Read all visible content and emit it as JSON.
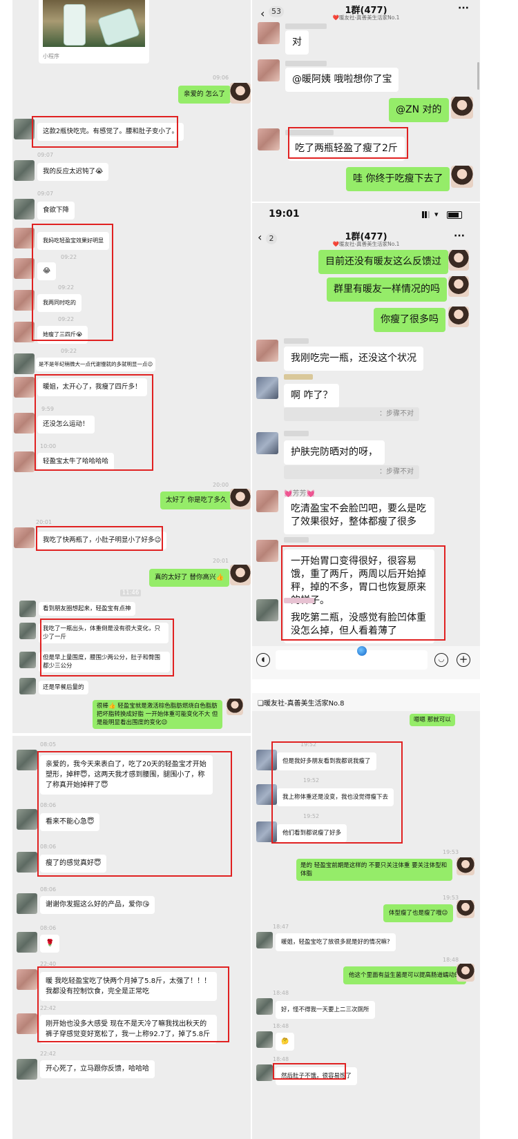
{
  "p1": {
    "mini_program": "小程序",
    "t1": "09:06",
    "m1": "亲爱的 怎么了",
    "m2": "这款2瓶快吃完。有感觉了。腰和肚子变小了。",
    "t2": "09:07",
    "m3": "我的反应太迟钝了😭",
    "t3": "09:07",
    "m4": "食欲下降",
    "m5": "我妈吃轻盈宝效果好明显",
    "t4": "09:22",
    "m6": "😂",
    "t5": "09:22",
    "m7": "我两同时吃的",
    "t6": "09:22",
    "m8": "她瘦了三四斤😭",
    "t7": "09:22",
    "m9": "是不是年纪稍微大一点代谢慢就的多就明显一点😉",
    "m10": "暖姐，太开心了，我瘦了四斤多！",
    "t8": "9:59",
    "m11": "还没怎么运动！",
    "t9": "10:00",
    "m12": "轻盈宝太牛了哈哈哈哈",
    "t10": "20:00",
    "m13": "太好了 你是吃了多久",
    "t11": "20:01",
    "m14": "我吃了快两瓶了，小肚子明显小了好多😉",
    "t12": "20:01",
    "m15": "真的太好了 替你高兴👍",
    "t13": "11:46",
    "m16": "看到朋友圈想起来，轻盈宝有点神",
    "m17": "我吃了一瓶出头，体重倒是没有很大变化，只少了一斤",
    "m18": "但是早上量围度，腰围少两公分，肚子和臀围都少三公分",
    "m19": "还是早餐后量的",
    "m20": "很棒👍 轻盈宝就是激活棕色脂肪燃烧白色脂肪 把坏脂转换成好脂 一开始体重可能变化不大 但是能明显看出围度的变化😉"
  },
  "p2": {
    "back_count": "53",
    "title": "1群(477)",
    "subtitle": "❤️暖友社-真善美生活家No.1",
    "more": "···",
    "m1": "对",
    "m2": "@暖阿姨 哦啦想你了宝",
    "m3": "@ZN 对的",
    "m4": "吃了两瓶轻盈了瘦了2斤",
    "m5": "哇 你终于吃瘦下去了"
  },
  "p3": {
    "status_time": "19:01",
    "back_count": "2",
    "title": "1群(477)",
    "subtitle": "❤️暖友社-真善美生活家No.1",
    "more": "···",
    "m1": "目前还没有暖友这么反馈过",
    "m2": "群里有暖友一样情况的吗",
    "m3": "你瘦了很多吗",
    "m4": "我刚吃完一瓶，还没这个状况",
    "m5": "啊 咋了？",
    "r1": "：步骤不对",
    "m6": "护肤完防晒对的呀，",
    "r2": "：步骤不对",
    "sender": "💓芳芳💓",
    "m7": "吃清盈宝不会脸凹吧，要么是吃了效果很好，整体都瘦了很多",
    "m8": "一开始胃口变得很好，很容易饿，重了两斤，两周以后开始掉秤，掉的不多，胃口也恢复原来的样子。",
    "m9": "我吃第二瓶，没感觉有脸凹体重没怎么掉，但人看着薄了"
  },
  "p4": {
    "t1": "08:05",
    "m1": "亲爱的，我今天来表白了，吃了20天的轻盈宝才开始塑形，掉秤😇，这两天我才感到腰围，腿围小了，称了称真开始掉秤了😇",
    "t2": "08:06",
    "m2": "看来不能心急😇",
    "t3": "08:06",
    "m3": "瘦了的感觉真好😇",
    "t4": "08:06",
    "m4": "谢谢你发掘这么好的产品，爱你😘",
    "t5": "08:06",
    "m5": "🌹",
    "t6": "22:40",
    "m6": "暖 我吃轻盈宝吃了快两个月掉了5.8斤，太强了！！！我都没有控制饮食，完全是正常吃",
    "t7": "22:42",
    "m7": "刚开始也没多大感受 现在不是天冷了嘛我找出秋天的裤子穿感觉变好宽松了，我一上称92.7了，掉了5.8斤",
    "t8": "22:42",
    "m8": "开心死了，立马跟你反馈，哈哈哈"
  },
  "p5": {
    "title": "❑暖友社-真善美生活家No.8",
    "m0": "嗯嗯 那就可以",
    "t1": "19:52",
    "m1": "但是我好多朋友看到我都说我瘦了",
    "t2": "19:52",
    "m2": "我上称体重还是没变，我也没觉得瘦下去",
    "t3": "19:52",
    "m3": "他们看到都说瘦了好多",
    "t4": "19:53",
    "m4": "是的 轻盈宝前期是这样的 不要只关注体重 要关注体型和体脂",
    "t5": "19:53",
    "m5": "体型瘦了也是瘦了哦😉",
    "t6": "18:47",
    "m6": "暖姐，轻盈宝吃了放很多屁是好的情况嘛?",
    "t7": "18:48",
    "m7": "他这个里面有益生菌是可以提高肠道蠕动的",
    "t8": "18:48",
    "m8": "好，怪不得我一天要上二三次厕所",
    "t9": "18:48",
    "m9": "🤔",
    "t10": "18:48",
    "m10": "然后肚子不饿，很容易饱了"
  }
}
